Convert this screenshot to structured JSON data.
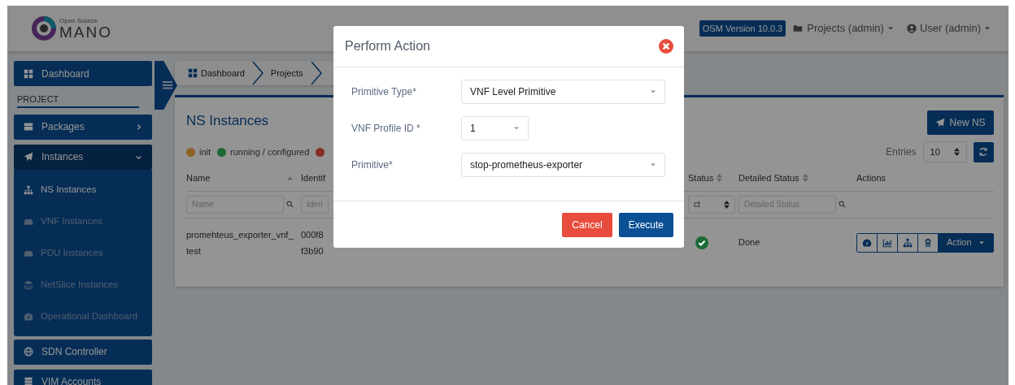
{
  "header": {
    "logo": {
      "subtitle": "Open Source",
      "title": "MANO"
    },
    "version_badge": "OSM Version 10.0.3",
    "projects_menu": "Projects (admin)",
    "user_menu": "User (admin)"
  },
  "sidebar": {
    "section_label": "PROJECT",
    "items": [
      {
        "label": "Dashboard",
        "selected": false
      },
      {
        "label": "Packages",
        "selected": false,
        "expanded": false
      },
      {
        "label": "Instances",
        "selected": true,
        "expanded": true,
        "children": [
          {
            "label": "NS Instances",
            "selected": true
          },
          {
            "label": "VNF Instances",
            "selected": false
          },
          {
            "label": "PDU Instances",
            "selected": false
          },
          {
            "label": "NetSlice Instances",
            "selected": false
          },
          {
            "label": "Operational Dashboard",
            "selected": false
          }
        ]
      },
      {
        "label": "SDN Controller",
        "selected": false
      },
      {
        "label": "VIM Accounts",
        "selected": false
      }
    ]
  },
  "breadcrumb": [
    "Dashboard",
    "Projects"
  ],
  "page": {
    "title": "NS Instances",
    "new_button": "New NS",
    "legend": [
      {
        "label": "init",
        "color": "#8c6224"
      },
      {
        "label": "running / configured",
        "color": "#1c6a35"
      },
      {
        "color": "#8a2c24"
      }
    ],
    "entries": {
      "label": "Entries",
      "value": "10"
    }
  },
  "table": {
    "columns": [
      {
        "label": "Name",
        "sorted": true
      },
      {
        "label": "Identif"
      },
      {
        "label": "Status",
        "sorted": false
      },
      {
        "label": "Detailed Status",
        "sorted": false
      },
      {
        "label": "Actions"
      }
    ],
    "filters": [
      {
        "kind": "search",
        "placeholder": "Name"
      },
      {
        "kind": "text",
        "placeholder": "Iden"
      },
      {
        "kind": "select",
        "value": "ct"
      },
      {
        "kind": "search",
        "placeholder": "Detailed Status"
      }
    ],
    "rows": [
      {
        "name": "promehteus_exporter_vnf_test",
        "identifier": [
          "000f8",
          "f3b90"
        ],
        "color": "#1c6a35",
        "detailed_status": "Done",
        "action_menu": "Action"
      }
    ]
  },
  "modal": {
    "title": "Perform Action",
    "fields": [
      {
        "kind": "select",
        "label": "Primitive Type*",
        "value": "VNF Level Primitive"
      },
      {
        "kind": "short-select",
        "label": "VNF Profile ID *",
        "value": "1"
      },
      {
        "kind": "select",
        "label": "Primitive*",
        "value": "stop-prometheus-exporter"
      }
    ],
    "buttons": [
      {
        "kind": "danger",
        "label": "Cancel"
      },
      {
        "kind": "primary",
        "label": "Execute"
      }
    ]
  }
}
